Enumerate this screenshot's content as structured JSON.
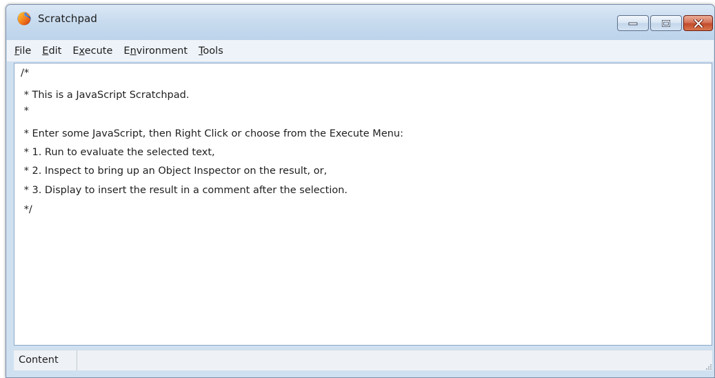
{
  "window": {
    "title": "Scratchpad",
    "icon": "firefox-icon",
    "caption_buttons": {
      "minimize_icon": "minimize-icon",
      "maximize_icon": "maximize-icon",
      "close_icon": "close-icon"
    }
  },
  "menubar": {
    "items": [
      {
        "label": "File",
        "access_key": "F"
      },
      {
        "label": "Edit",
        "access_key": "E"
      },
      {
        "label": "Execute",
        "access_key": "x"
      },
      {
        "label": "Environment",
        "access_key": "n"
      },
      {
        "label": "Tools",
        "access_key": "T"
      }
    ]
  },
  "editor": {
    "lines": [
      "/*",
      " * This is a JavaScript Scratchpad.",
      " *",
      " * Enter some JavaScript, then Right Click or choose from the Execute Menu:",
      " * 1. Run to evaluate the selected text,",
      " * 2. Inspect to bring up an Object Inspector on the result, or,",
      " * 3. Display to insert the result in a comment after the selection.",
      " */"
    ]
  },
  "statusbar": {
    "environment": "Content"
  },
  "colors": {
    "titlebar": "#c9dcef",
    "close_button": "#c24b2b",
    "editor_border": "#8aa7c6"
  }
}
